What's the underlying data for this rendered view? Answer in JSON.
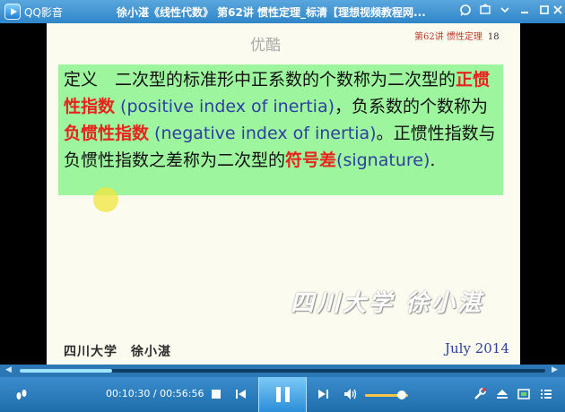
{
  "titlebar": {
    "app_name": "QQ影音",
    "window_title": "徐小湛《线性代数》 第62讲 惯性定理_标清【理想视频教程网..."
  },
  "slide": {
    "watermark_top": "优酷",
    "lecture_tag": "第62讲 惯性定理",
    "page_number": "18",
    "definition": {
      "p1": "定义　二次型的标准形中正系数的个数称为二次型的",
      "term1": "正惯性指数",
      "en1": " (positive index of inertia)",
      "p2": "，负系数的个数称为",
      "term2": "负惯性指数",
      "en2": " (negative index of inertia)",
      "p3": "。正惯性指数与负惯性指数之差称为二次型的",
      "term3": "符号差",
      "en3": "(signature)",
      "p4": "."
    },
    "watermark_bottom": "四川大学 徐小湛",
    "footer_left": "四川大学　徐小湛",
    "footer_right": "July 2014"
  },
  "player": {
    "progress_fraction": 0.176,
    "time_display": "00:10:30 / 00:56:56",
    "volume_fraction": 0.85
  }
}
